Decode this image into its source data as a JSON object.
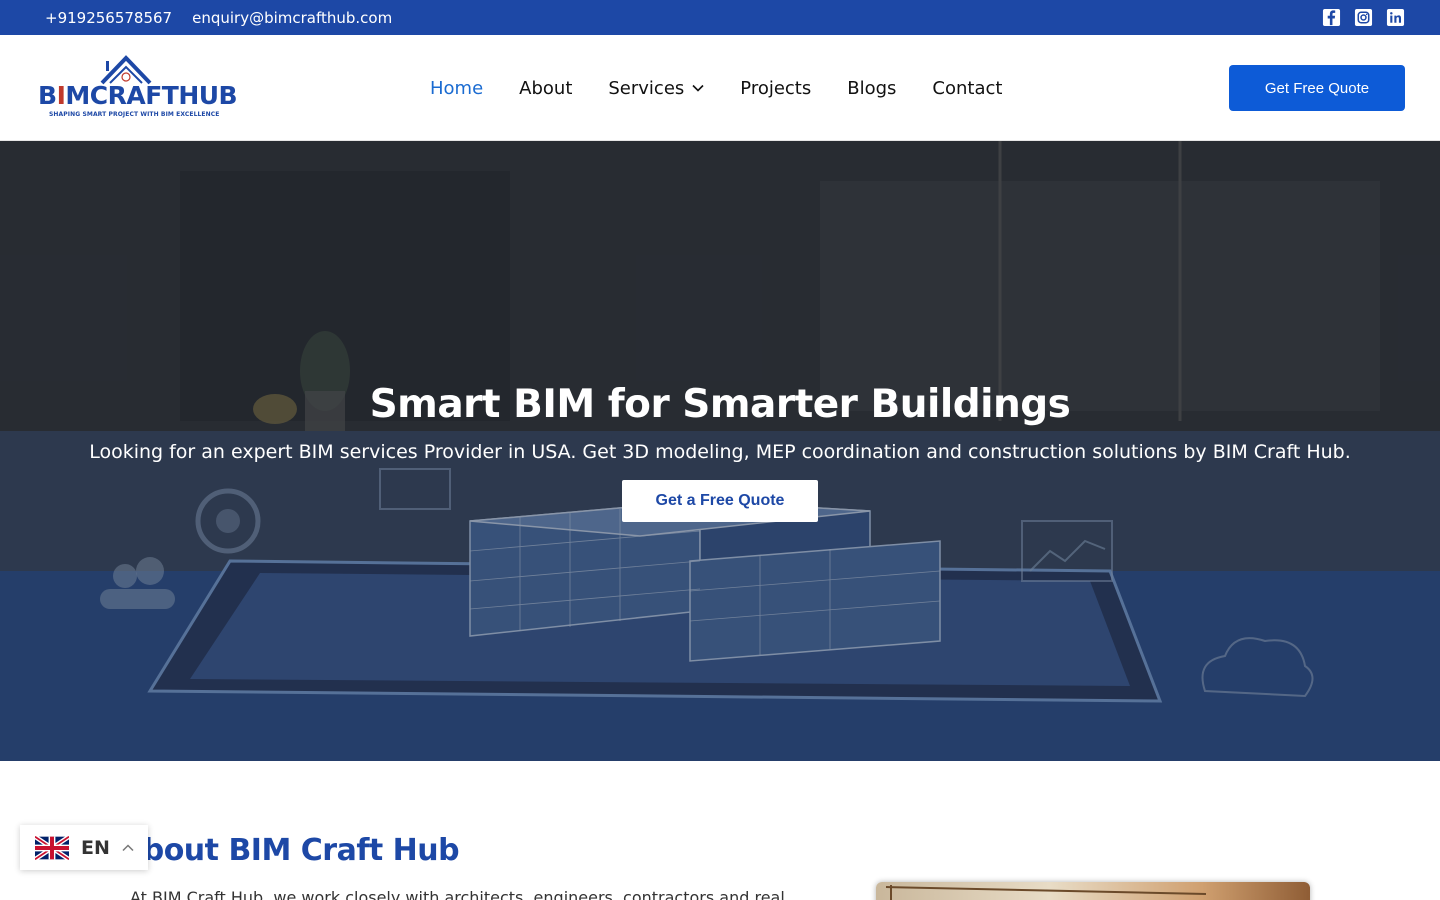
{
  "topbar": {
    "phone": "+919256578567",
    "email": "enquiry@bimcrafthub.com",
    "social": [
      "facebook-icon",
      "instagram-icon",
      "linkedin-icon"
    ]
  },
  "logo": {
    "name_part1": "B",
    "name_part2": "MCRAFTHUB",
    "tagline": "SHAPING SMART PROJECT WITH BIM EXCELLENCE"
  },
  "nav": {
    "items": [
      {
        "label": "Home",
        "active": true
      },
      {
        "label": "About"
      },
      {
        "label": "Services",
        "has_dropdown": true
      },
      {
        "label": "Projects"
      },
      {
        "label": "Blogs"
      },
      {
        "label": "Contact"
      }
    ],
    "cta": "Get Free Quote"
  },
  "hero": {
    "title": "Smart BIM for Smarter Buildings",
    "subtitle": "Looking for an expert BIM services Provider in USA. Get 3D modeling, MEP coordination and construction solutions by BIM Craft Hub.",
    "button": "Get a Free Quote"
  },
  "about": {
    "title": "About BIM Craft Hub",
    "text": "At BIM Craft Hub, we work closely with architects, engineers, contractors and real"
  },
  "language": {
    "code": "EN",
    "flag": "uk-flag-icon"
  },
  "colors": {
    "brand": "#1d48a6",
    "accent": "#1a6bd1",
    "button": "#0d5bd7"
  }
}
